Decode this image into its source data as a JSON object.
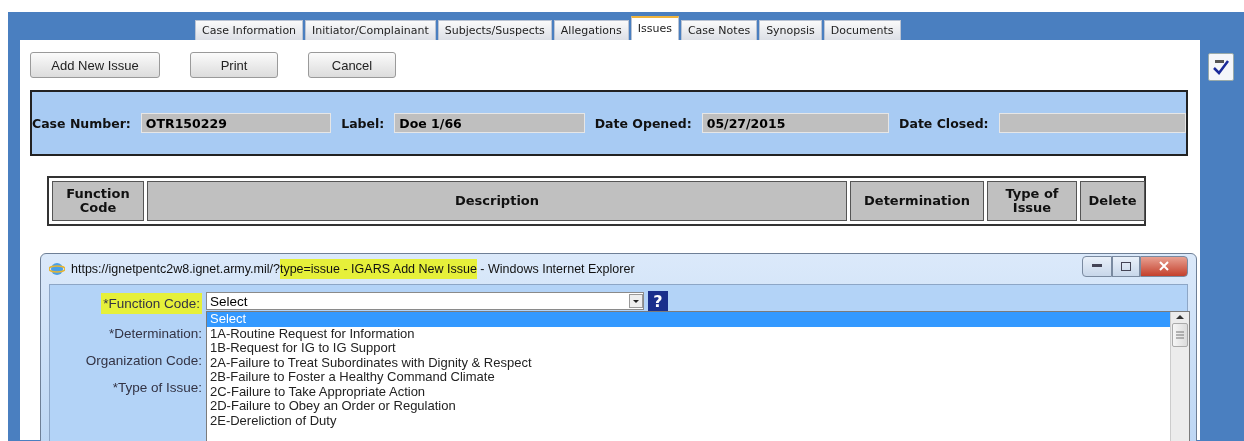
{
  "tabs": [
    {
      "label": "Case Information",
      "selected": false
    },
    {
      "label": "Initiator/Complainant",
      "selected": false
    },
    {
      "label": "Subjects/Suspects",
      "selected": false
    },
    {
      "label": "Allegations",
      "selected": false
    },
    {
      "label": "Issues",
      "selected": true
    },
    {
      "label": "Case Notes",
      "selected": false
    },
    {
      "label": "Synopsis",
      "selected": false
    },
    {
      "label": "Documents",
      "selected": false
    }
  ],
  "toolbar": [
    "Add New Issue",
    "Print",
    "Cancel"
  ],
  "case_fields": [
    {
      "label": "Case Number:",
      "value": "OTR150229"
    },
    {
      "label": "Label:",
      "value": "Doe 1/66"
    },
    {
      "label": "Date Opened:",
      "value": "05/27/2015"
    },
    {
      "label": "Date Closed:"
    }
  ],
  "table": {
    "columns": [
      "Function Code",
      "Description",
      "Determination",
      "Type of Issue",
      "Delete"
    ]
  },
  "popup": {
    "title_parts": [
      {
        "text": "https://ignetpentc2w8.ignet.army.mil/?",
        "highlighted": false
      },
      {
        "text": "type=issue - IGARS Add New Issue",
        "highlighted": true
      },
      {
        "text": " - Windows Internet Explorer",
        "highlighted": false
      }
    ],
    "form_labels": [
      {
        "text": "*Function Code:",
        "highlighted": true
      },
      {
        "text": "*Determination:",
        "highlighted": false
      },
      {
        "text": "Organization Code:",
        "highlighted": false
      },
      {
        "text": "*Type of Issue:",
        "highlighted": false
      }
    ],
    "select_value": "Select",
    "help_icon": "?",
    "options": [
      {
        "label": "Select",
        "selected": true
      },
      {
        "label": "1A-Routine Request for Information",
        "selected": false
      },
      {
        "label": "1B-Request for IG to IG Support",
        "selected": false
      },
      {
        "label": "2A-Failure to Treat Subordinates with Dignity & Respect",
        "selected": false
      },
      {
        "label": "2B-Failure to Foster a Healthy Command Climate",
        "selected": false
      },
      {
        "label": "2C-Failure to Take Appropriate Action",
        "selected": false
      },
      {
        "label": "2D-Failure to Obey an Order or Regulation",
        "selected": false
      },
      {
        "label": "2E-Dereliction of Duty",
        "selected": false
      }
    ]
  }
}
